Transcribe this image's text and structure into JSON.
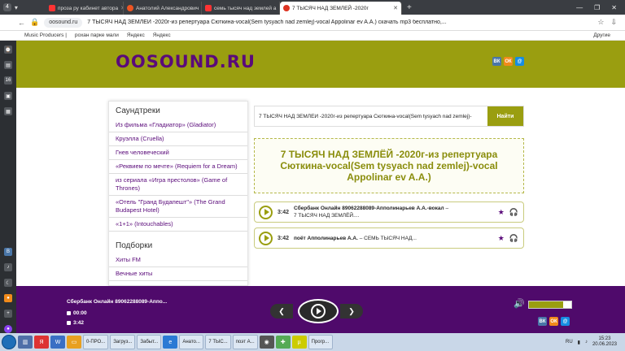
{
  "browser": {
    "tab_count": "4",
    "tabs": [
      {
        "label": "проза ру кабинет автора"
      },
      {
        "label": "Анатолий Александрович"
      },
      {
        "label": "семь тысяч над землей а"
      },
      {
        "label": "7 ТЫСЯЧ НАД ЗЕМЛЕЙ -2020г"
      }
    ],
    "url_domain": "oosound.ru",
    "url_title": "7 ТЫСЯЧ НАД ЗЕМЛЕЙ -2020г-из репертуара Сюткина-vocal(Sem tysyach nad zemlej)-vocal Appolinar ev A.A.) скачать mp3 бесплатно,...",
    "bookmarks": [
      "Music Producers |",
      "рохан парке мали",
      "Яндекс",
      "Яндекс"
    ],
    "bookmarks_other": "Другие"
  },
  "site": {
    "logo": "OOSOUND.RU",
    "social": [
      "ВК",
      "ОК",
      "@"
    ]
  },
  "sidebar": {
    "soundtracks_title": "Саундтреки",
    "soundtracks": [
      "Из фильма «Гладиатор» (Gladiator)",
      "Круэлла (Cruella)",
      "Гнев человеческий",
      "«Реквием по мечте» (Requiem for a Dream)",
      "из сериала «Игра престолов» (Game of Thrones)",
      "«Отель \"Гранд Будапешт\"» (The Grand Budapest Hotel)",
      "«1+1» (Intouchables)"
    ],
    "collections_title": "Подборки",
    "collections": [
      "Хиты FM",
      "Вечные хиты"
    ]
  },
  "search": {
    "value": "7 ТЫСЯЧ НАД ЗЕМЛЁЙ -2020г-из репертуара Сюткина-vocal(Sem tysyach nad zemlej)-",
    "button": "Найти"
  },
  "page_title": "7 ТЫСЯЧ НАД ЗЕМЛЁЙ -2020г-из репертуара Сюткина-vocal(Sem tysyach nad zemlej)-vocal Appolinar ev A.A.)",
  "tracks": [
    {
      "duration": "3:42",
      "artist": "Сбербанк Онлайн 89062288089-Апполинарьев А.А.-вокал",
      "dash": " – ",
      "title": "7 ТЫСЯЧ НАД ЗЕМЛЁЙ...."
    },
    {
      "duration": "3:42",
      "artist": "поёт Апполинарьев А.А.",
      "dash": " – ",
      "title": "СЕМЬ ТЫСЯЧ НАД..."
    }
  ],
  "player": {
    "now_playing": "Сбербанк Онлайн 89062288089-Аппо...",
    "current_time": "00:00",
    "duration": "3:42",
    "volume": 0.8
  },
  "taskbar": {
    "buttons": [
      "0-ПРО...",
      "Загруз...",
      "Забыт...",
      "Анато...",
      "7 ТЫС...",
      "поэт А...",
      "Прогр..."
    ],
    "lang": "RU",
    "time": "15:23",
    "date": "20.06.2023"
  },
  "colors": {
    "olive": "#9a9e10",
    "purple": "#4f0a6b"
  }
}
